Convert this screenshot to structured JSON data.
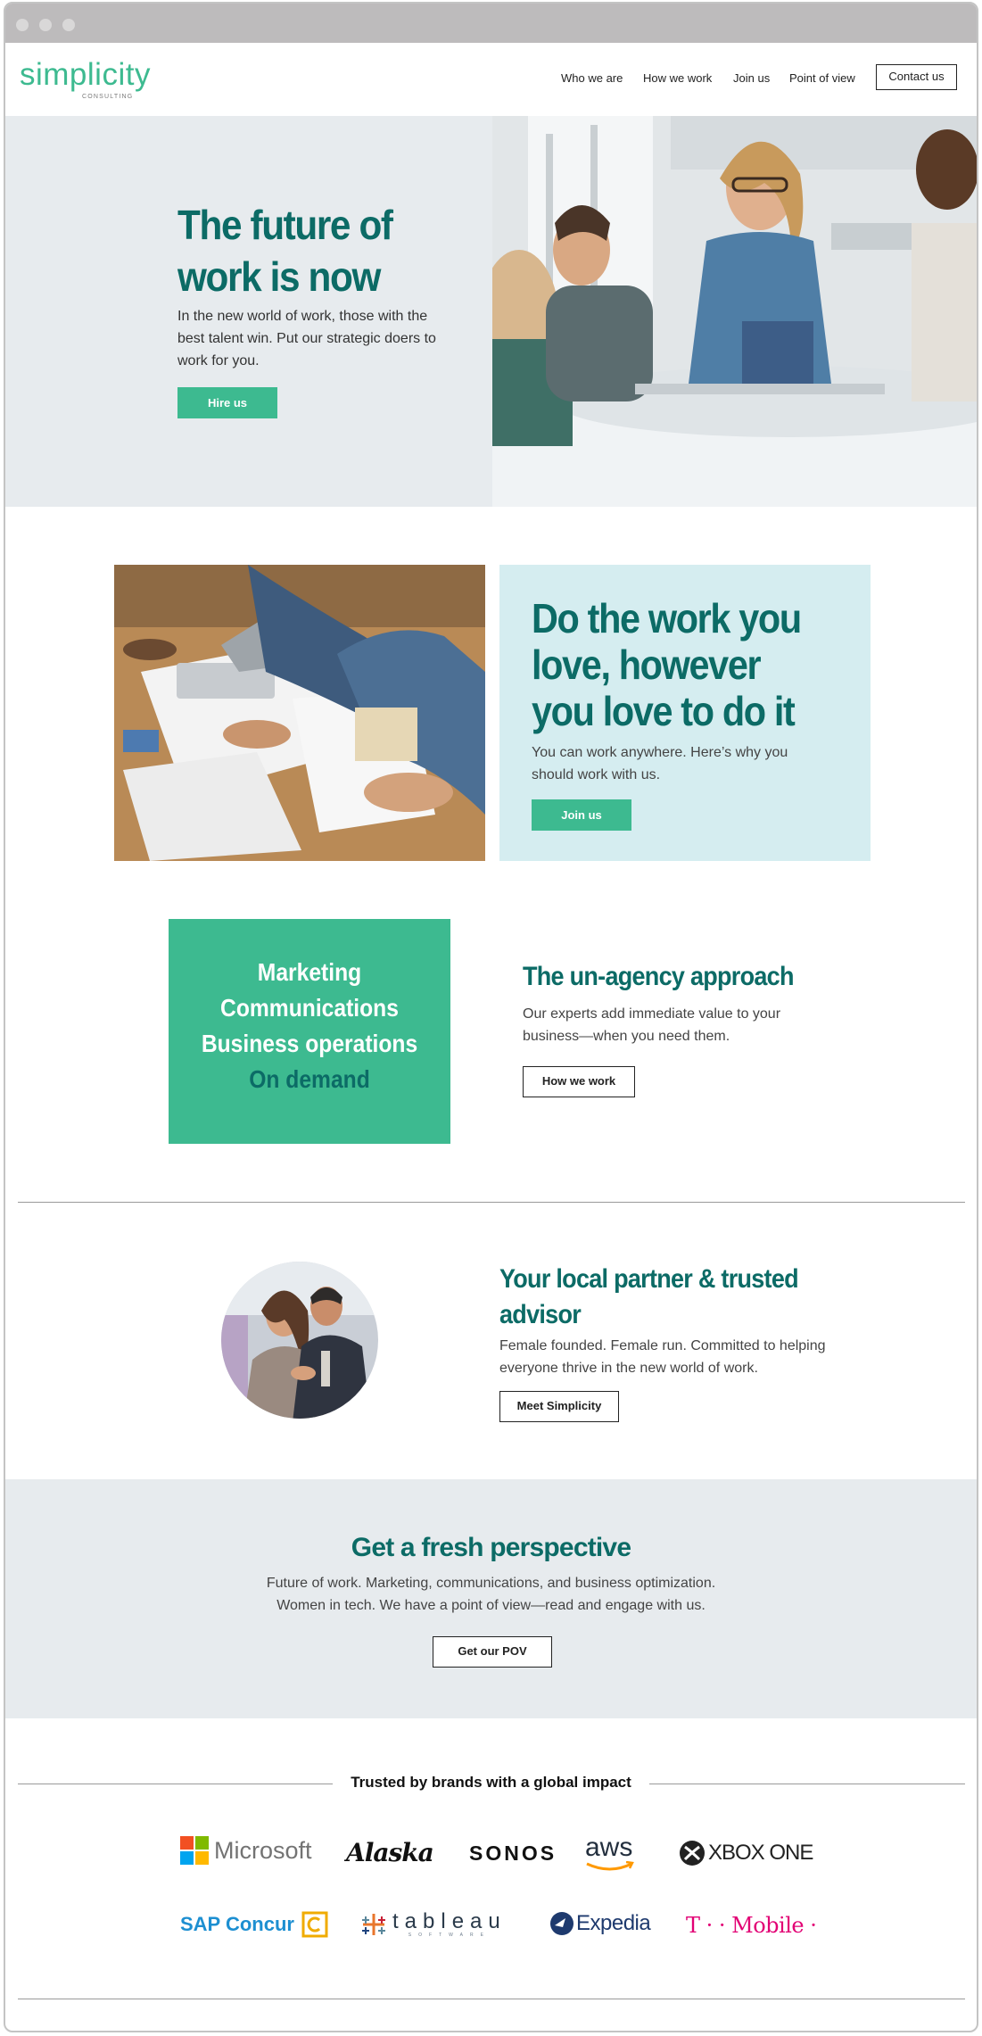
{
  "header": {
    "logo": {
      "name": "simplicity",
      "tagline": "CONSULTING"
    },
    "nav": [
      "Who we are",
      "How we work",
      "Join us",
      "Point of view"
    ],
    "contact_label": "Contact us"
  },
  "hero": {
    "title": "The future of work is now",
    "text": "In the new world of work, those with the best talent win. Put our strategic doers to work for you.",
    "button": "Hire us"
  },
  "work": {
    "title": "Do the work you love, however you love to do it",
    "text": "You can work anywhere. Here’s why you should work with us.",
    "button": "Join us"
  },
  "services": {
    "lines": [
      "Marketing",
      "Communications",
      "Business operations",
      "On demand"
    ],
    "title": "The un-agency approach",
    "text": "Our experts add immediate value to your business—when you need them.",
    "button": "How we work"
  },
  "partner": {
    "title": "Your local partner & trusted advisor",
    "text": "Female founded. Female run. Committed to helping everyone thrive in the new world of work.",
    "button": "Meet Simplicity"
  },
  "perspective": {
    "title": "Get a fresh perspective",
    "text_line1": "Future of work. Marketing, communications, and business optimization.",
    "text_line2": "Women in tech. We have a point of view—read and engage with us.",
    "button": "Get our POV"
  },
  "brands": {
    "heading": "Trusted by brands with a global impact",
    "row1": [
      "Microsoft",
      "Alaska",
      "SONOS",
      "aws",
      "XBOX ONE"
    ],
    "row2": [
      "SAP Concur",
      "tableau",
      "SOFTWARE",
      "Expedia",
      "T · · Mobile ·"
    ]
  },
  "colors": {
    "brand_green": "#3dba90",
    "dark_teal": "#0c6b66",
    "light_gray": "#e7ebee",
    "light_teal": "#d5edf0"
  }
}
